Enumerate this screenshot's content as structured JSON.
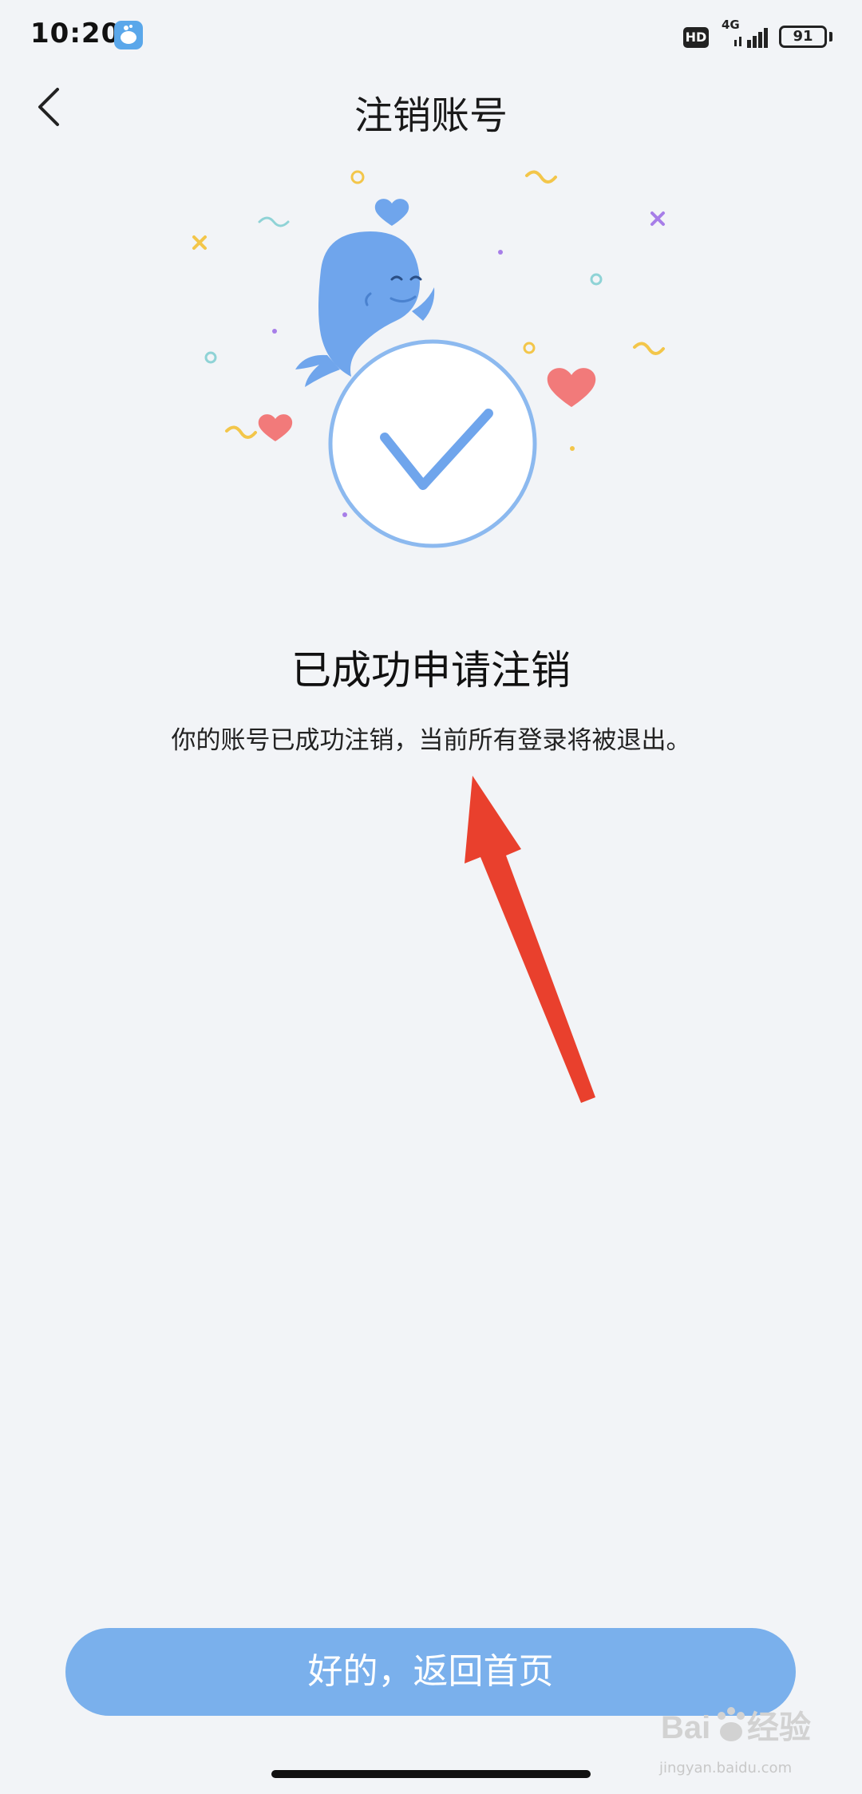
{
  "status_bar": {
    "time": "10:20",
    "hd_label": "HD",
    "network": "4G",
    "battery": "91"
  },
  "nav": {
    "title": "注销账号",
    "back_icon": "chevron-left-icon"
  },
  "illustration": {
    "name": "whale-success-illustration",
    "colors": {
      "whale": "#6fa5ec",
      "check": "#6fa5ec",
      "heart": "#f27a7a",
      "confetti_yellow": "#f3c64a",
      "confetti_purple": "#a77ee8",
      "confetti_teal": "#8fd3d6"
    }
  },
  "result": {
    "title": "已成功申请注销",
    "description": "你的账号已成功注销，当前所有登录将被退出。"
  },
  "annotation": {
    "arrow_color": "#e9402d"
  },
  "footer": {
    "button_label": "好的，返回首页"
  },
  "watermark": {
    "brand": "Baidu经验",
    "url": "jingyan.baidu.com"
  }
}
